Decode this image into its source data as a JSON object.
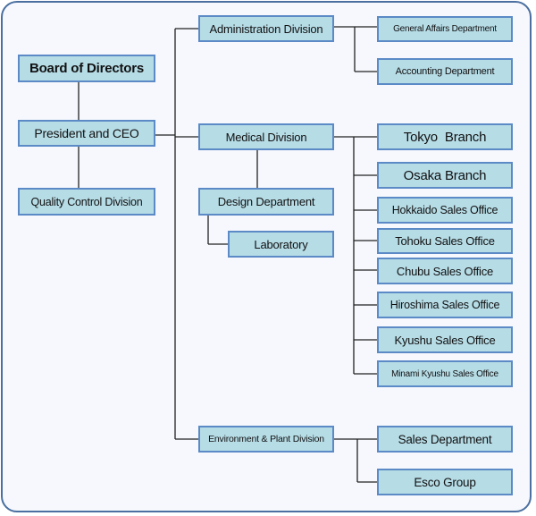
{
  "diagram": {
    "type": "organization-chart",
    "colors": {
      "box_fill": "#b6dce6",
      "box_border": "#5b8ac6",
      "frame_border": "#4a6fa0",
      "background": "#f6f8fd",
      "line": "#222222"
    },
    "nodes": {
      "board": "Board of Directors",
      "president": "President and CEO",
      "quality": "Quality Control Division",
      "admin": "Administration Division",
      "general_affairs": "General Affairs Department",
      "accounting": "Accounting Department",
      "medical": "Medical Division",
      "design": "Design Department",
      "laboratory": "Laboratory",
      "tokyo": "Tokyo  Branch",
      "osaka": "Osaka Branch",
      "hokkaido": "Hokkaido Sales Office",
      "tohoku": "Tohoku Sales Office",
      "chubu": "Chubu Sales Office",
      "hiroshima": "Hiroshima Sales Office",
      "kyushu": "Kyushu Sales Office",
      "minami_kyushu": "Minami Kyushu Sales Office",
      "environment": "Environment & Plant Division",
      "sales_dept": "Sales Department",
      "esco": "Esco Group"
    },
    "edges": [
      [
        "board",
        "president"
      ],
      [
        "president",
        "quality"
      ],
      [
        "president",
        "admin"
      ],
      [
        "president",
        "medical"
      ],
      [
        "president",
        "environment"
      ],
      [
        "admin",
        "general_affairs"
      ],
      [
        "admin",
        "accounting"
      ],
      [
        "medical",
        "design"
      ],
      [
        "design",
        "laboratory"
      ],
      [
        "medical",
        "tokyo"
      ],
      [
        "medical",
        "osaka"
      ],
      [
        "medical",
        "hokkaido"
      ],
      [
        "medical",
        "tohoku"
      ],
      [
        "medical",
        "chubu"
      ],
      [
        "medical",
        "hiroshima"
      ],
      [
        "medical",
        "kyushu"
      ],
      [
        "medical",
        "minami_kyushu"
      ],
      [
        "environment",
        "sales_dept"
      ],
      [
        "environment",
        "esco"
      ]
    ]
  }
}
